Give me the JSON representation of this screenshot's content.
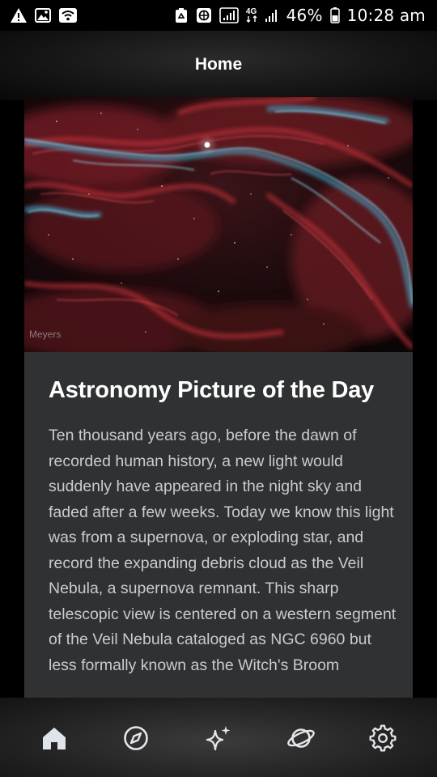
{
  "status_bar": {
    "icons_left": [
      "warning-icon",
      "image-icon",
      "wifi-icon"
    ],
    "icons_right": [
      "recycle-icon",
      "sync-icon",
      "signal-icon",
      "4g-icon",
      "signal-weak-icon",
      "battery-icon"
    ],
    "network_label": "4G",
    "battery_percent": "46%",
    "time": "10:28 am"
  },
  "header": {
    "title": "Home"
  },
  "card": {
    "image_credit": "Meyers",
    "title": "Astronomy Picture of the Day",
    "body": "Ten thousand years ago, before the dawn of recorded human history, a new light would suddenly have appeared in the night sky and faded after a few weeks.  Today we know this light was from a supernova, or exploding star, and record the expanding debris cloud as the Veil Nebula, a supernova remnant.  This sharp telescopic view is centered on a western segment of the Veil Nebula cataloged as NGC 6960 but less formally known as the Witch's Broom"
  },
  "bottom_nav": {
    "items": [
      {
        "icon": "home-icon",
        "active": true
      },
      {
        "icon": "compass-icon",
        "active": false
      },
      {
        "icon": "sparkle-icon",
        "active": false
      },
      {
        "icon": "planet-icon",
        "active": false
      },
      {
        "icon": "gear-icon",
        "active": false
      }
    ]
  },
  "colors": {
    "background": "#000000",
    "card": "#2f3133",
    "body_text": "#c9cbcd",
    "nav_active": "#dfe3ea",
    "nav_icon": "#e3e6ea",
    "nebula_red": "#c2323a",
    "nebula_cyan": "#3fb2d6"
  }
}
